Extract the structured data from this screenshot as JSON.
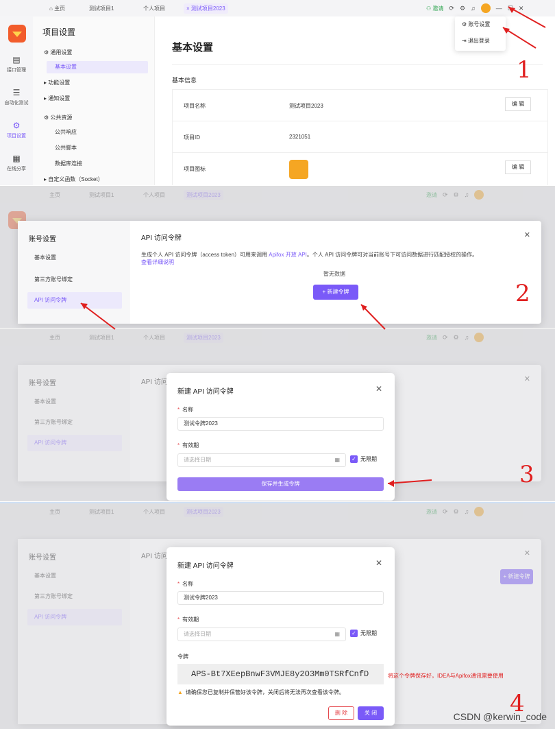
{
  "topbar": {
    "tabs": [
      "主页",
      "测试项目1",
      "个人项目",
      "测试项目2023"
    ],
    "invite": "邀请"
  },
  "leftnav": [
    "接口管理",
    "自动化测试",
    "项目设置",
    "在线分享"
  ],
  "subnav": {
    "title": "项目设置",
    "items": [
      "通用设置",
      "基本设置",
      "功能设置",
      "通知设置",
      "公共资源",
      "公共响应",
      "公共脚本",
      "数据库连接",
      "自定义函数（Socket）"
    ]
  },
  "main": {
    "title": "基本设置",
    "section": "基本信息",
    "rows": [
      {
        "key": "项目名称",
        "value": "测试项目2023",
        "action": "编 辑"
      },
      {
        "key": "项目ID",
        "value": "2321051",
        "action": ""
      },
      {
        "key": "项目图标",
        "value": "",
        "action": "编 辑"
      }
    ]
  },
  "dropdown": [
    "账号设置",
    "退出登录"
  ],
  "account": {
    "title": "账号设置",
    "items": [
      "基本设置",
      "第三方账号绑定",
      "API 访问令牌"
    ],
    "token_title": "API 访问令牌",
    "desc_a": "生成个人 API 访问令牌（access token）可用来调用",
    "desc_link": "Apifox 开放 API",
    "desc_b": "。个人 API 访问令牌可对当前账号下可访问数据进行匹配授权的操作。",
    "desc_more": "查看详细说明",
    "empty": "暂无数据",
    "new_btn": "+ 新建令牌"
  },
  "modal": {
    "title": "新建 API 访问令牌",
    "name_label": "名称",
    "name_value": "测试令牌2023",
    "expire_label": "有效期",
    "date_placeholder": "请选择日期",
    "no_limit": "无限期",
    "save_btn": "保存并生成令牌",
    "token_label": "令牌",
    "token_value": "APS-Bt7XEepBnwF3VMJE8y2O3Mm0TSRfCnfD",
    "warning": "请确保您已复制并保管好该令牌，关闭后将无法再次查看该令牌。",
    "delete_btn": "删 除",
    "close_btn": "关 闭"
  },
  "annotations": {
    "note": "将这个令牌保存好，IDEA与Apifox通讯需要使用",
    "steps": [
      "1",
      "2",
      "3",
      "4"
    ],
    "watermark": "CSDN @kerwin_code"
  }
}
